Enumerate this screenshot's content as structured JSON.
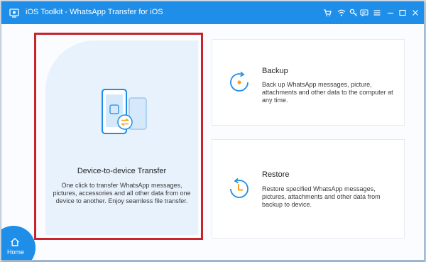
{
  "titlebar": {
    "title": "iOS Toolkit - WhatsApp Transfer for iOS",
    "buttons": [
      "cart-icon",
      "wifi-icon",
      "key-icon",
      "chat-icon",
      "menu-icon",
      "minimize-icon",
      "maximize-icon",
      "close-icon"
    ]
  },
  "main": {
    "device_transfer": {
      "title": "Device-to-device Transfer",
      "description": "One click to transfer WhatsApp messages, pictures, accessories and all other data from one device to another. Enjoy seamless file transfer."
    },
    "backup": {
      "title": "Backup",
      "description": "Back up WhatsApp messages, picture, attachments and other data to the computer at any time."
    },
    "restore": {
      "title": "Restore",
      "description": "Restore specified WhatsApp messages, pictures, attachments and other data from backup to device."
    }
  },
  "home": {
    "label": "Home"
  },
  "colors": {
    "accent": "#1e8ee8",
    "highlight_border": "#c8242b",
    "card_selected_bg": "#e8f2fc",
    "icon_orange": "#f5a623"
  }
}
